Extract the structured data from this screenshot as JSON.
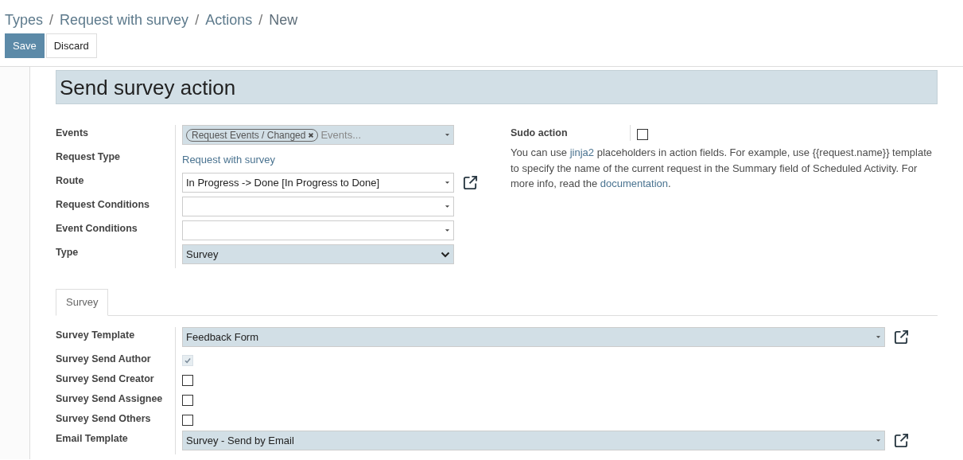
{
  "breadcrumb": [
    "Types",
    "Request with survey",
    "Actions",
    "New"
  ],
  "breadcrumb_separator": "/",
  "buttons": [
    {
      "label": "Save",
      "kind": "primary"
    },
    {
      "label": "Discard",
      "kind": "secondary"
    }
  ],
  "title": "Send survey action",
  "main_fields": [
    {
      "label": "Events",
      "kind": "tags",
      "required": true,
      "tags": [
        "Request Events / Changed"
      ],
      "placeholder": "Events..."
    },
    {
      "label": "Request Type",
      "kind": "link",
      "value": "Request with survey"
    },
    {
      "label": "Route",
      "kind": "select",
      "required": false,
      "value": "In Progress -> Done [In Progress to Done]",
      "external_link": true
    },
    {
      "label": "Request Conditions",
      "kind": "select",
      "required": false,
      "external_link": false
    },
    {
      "label": "Event Conditions",
      "kind": "select",
      "required": false,
      "external_link": false
    },
    {
      "label": "Type",
      "kind": "dropdown",
      "required": true,
      "value": "Survey"
    }
  ],
  "sudo": {
    "label": "Sudo action",
    "checked": false,
    "disabled": false
  },
  "help_text": [
    {
      "kind": "text",
      "text": "You can use "
    },
    {
      "kind": "link",
      "text": "jinja2"
    },
    {
      "kind": "text",
      "text": " placeholders in action fields. For example, use {{request.name}} template to specify the name of the current request in the Summary field of Scheduled Activity. For more info, read the "
    },
    {
      "kind": "link",
      "text": "documentation"
    },
    {
      "kind": "text",
      "text": "."
    }
  ],
  "tabs": [
    {
      "label": "Survey",
      "selected": true
    }
  ],
  "survey_fields": [
    {
      "label": "Survey Template",
      "kind": "select",
      "required": true,
      "value": "Feedback Form",
      "external_link": true
    },
    {
      "label": "Survey Send Author",
      "kind": "checkbox",
      "checked": true,
      "disabled": true
    },
    {
      "label": "Survey Send Creator",
      "kind": "checkbox",
      "checked": false,
      "disabled": false
    },
    {
      "label": "Survey Send Assignee",
      "kind": "checkbox",
      "checked": false,
      "disabled": false
    },
    {
      "label": "Survey Send Others",
      "kind": "checkbox",
      "checked": false,
      "disabled": false
    },
    {
      "label": "Email Template",
      "kind": "select",
      "required": true,
      "value": "Survey - Send by Email",
      "external_link": true
    }
  ]
}
